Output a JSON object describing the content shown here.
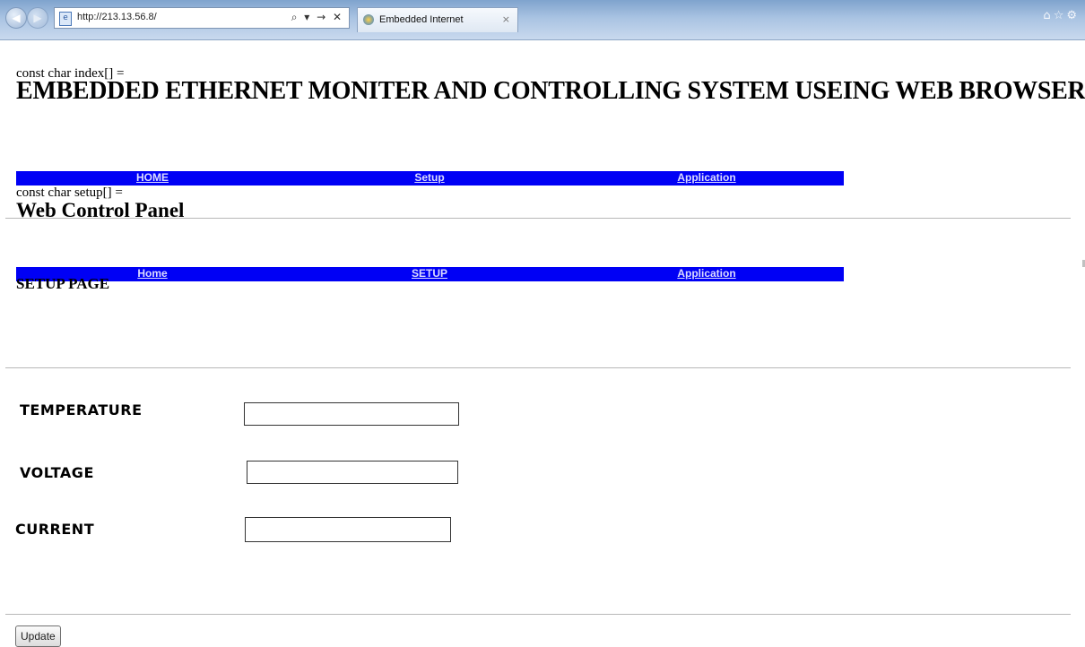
{
  "browser": {
    "url": "http://213.13.56.8/",
    "tab_title": "Embedded Internet",
    "tab_close": "×",
    "address_tools": "⌕ ▾ → ✕",
    "icons": [
      "back-arrow-icon",
      "forward-arrow-icon",
      "page-icon",
      "home-icon",
      "star-icon",
      "gear-icon"
    ]
  },
  "page": {
    "code_index": "const char index[] =",
    "main_title": "EMBEDDED ETHERNET MONITER AND CONTROLLING SYSTEM USEING WEB BROWSER”",
    "nav1": {
      "home": "HOME",
      "setup": "Setup",
      "application": "Application"
    },
    "code_setup": "const char setup[] =",
    "panel_title": "Web Control Panel",
    "nav2": {
      "home": "Home",
      "setup": "SETUP",
      "application": "Application"
    },
    "setup_heading": "SETUP PAGE",
    "fields": {
      "temperature_label": "TEMPERATURE",
      "temperature_value": "",
      "voltage_label": "VOLTAGE",
      "voltage_value": "",
      "current_label": "CURRENT",
      "current_value": ""
    },
    "update_button": "Update"
  },
  "colors": {
    "navbar_bg": "#0000f5",
    "nav_link": "#dcdcff",
    "chrome_gradient_top": "#7fa3cd"
  }
}
